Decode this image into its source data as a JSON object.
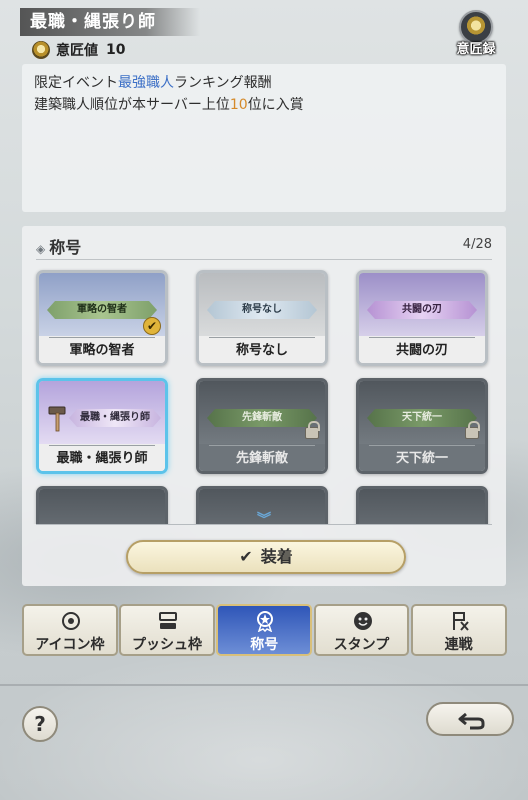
{
  "header": {
    "title": "最職・縄張り師",
    "ishou_label": "意匠値",
    "ishou_value": "10",
    "record_button_label": "意匠録"
  },
  "description": {
    "line1_pre": "限定イベント",
    "line1_highlight": "最強職人",
    "line1_post": "ランキング報酬",
    "line2_pre": "建築職人順位が本サーバー上位",
    "line2_highlight": "10",
    "line2_post": "位に入賞"
  },
  "titles_panel": {
    "heading": "称号",
    "count": "4/28",
    "cards": [
      {
        "banner": "軍略の智者",
        "name": "軍略の智者",
        "state": "equipped"
      },
      {
        "banner": "称号なし",
        "name": "称号なし",
        "state": "owned"
      },
      {
        "banner": "共闘の刃",
        "name": "共闘の刃",
        "state": "owned"
      },
      {
        "banner": "最職・縄張り師",
        "name": "最職・縄張り師",
        "state": "selected"
      },
      {
        "banner": "先鋒斬敵",
        "name": "先鋒斬敵",
        "state": "locked"
      },
      {
        "banner": "天下統一",
        "name": "天下統一",
        "state": "locked"
      }
    ],
    "equip_button_label": "装着"
  },
  "tabs": [
    {
      "label": "アイコン枠",
      "icon": "icon-frame-icon",
      "active": false
    },
    {
      "label": "プッシュ枠",
      "icon": "push-frame-icon",
      "active": false
    },
    {
      "label": "称号",
      "icon": "title-medal-icon",
      "active": true
    },
    {
      "label": "スタンプ",
      "icon": "stamp-face-icon",
      "active": false
    },
    {
      "label": "連戦",
      "icon": "consecutive-battle-icon",
      "active": false
    }
  ],
  "footer": {
    "help_label": "?",
    "back_icon": "return-arrow-icon"
  },
  "colors": {
    "highlight_blue": "#3c6fc6",
    "highlight_orange": "#d58a2a",
    "active_tab": "#2f56b8",
    "selected_card_border": "#5cc3ea"
  }
}
